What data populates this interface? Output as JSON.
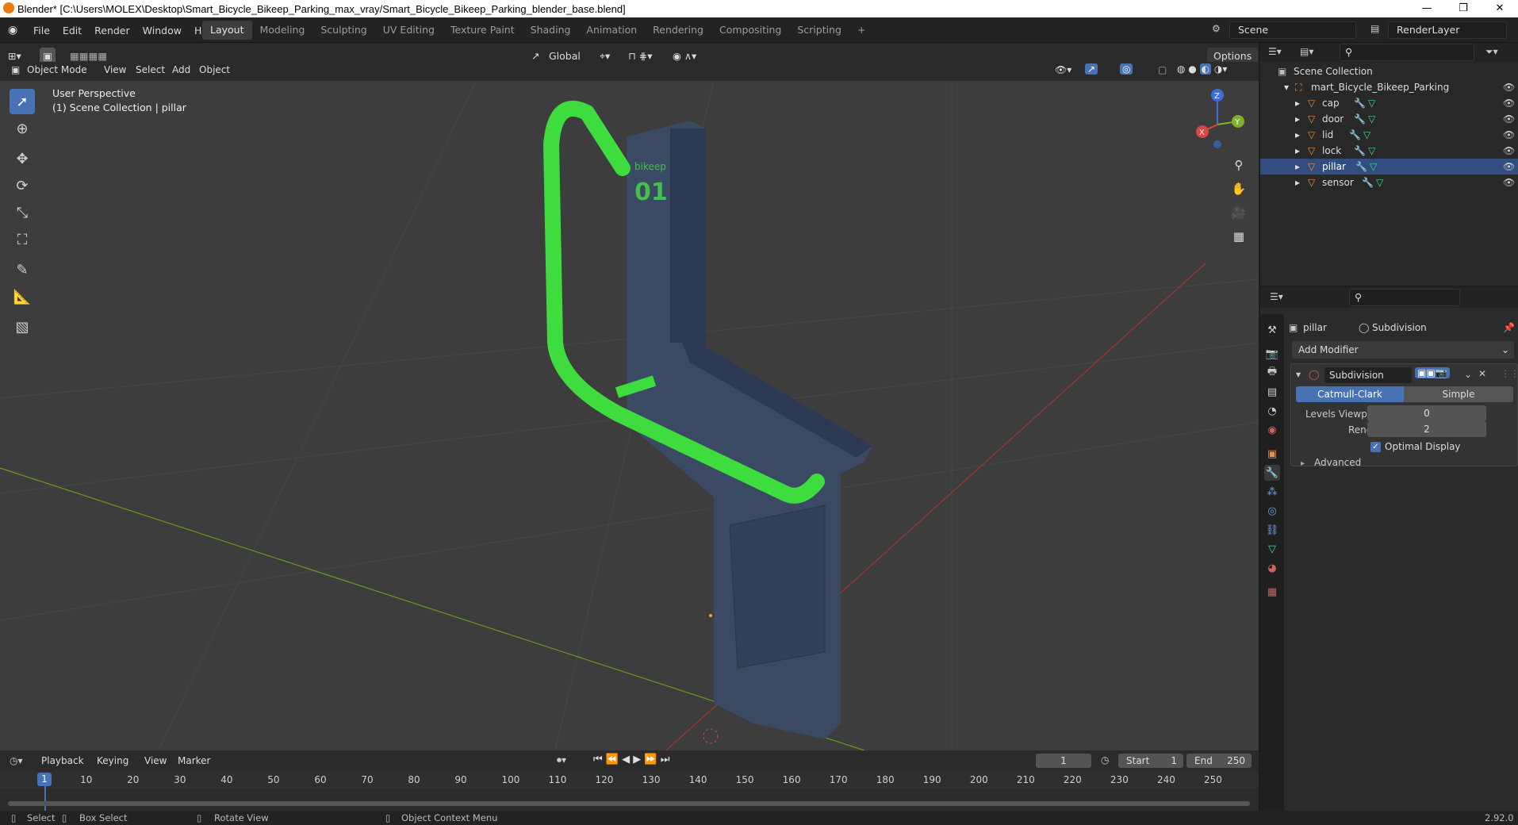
{
  "title": "Blender* [C:\\Users\\MOLEX\\Desktop\\Smart_Bicycle_Bikeep_Parking_max_vray/Smart_Bicycle_Bikeep_Parking_blender_base.blend]",
  "menu": [
    "File",
    "Edit",
    "Render",
    "Window",
    "Help"
  ],
  "workspaces": [
    "Layout",
    "Modeling",
    "Sculpting",
    "UV Editing",
    "Texture Paint",
    "Shading",
    "Animation",
    "Rendering",
    "Compositing",
    "Scripting"
  ],
  "scene": "Scene",
  "view_layer": "RenderLayer",
  "viewport_header": {
    "mode": "Object Mode",
    "menus": [
      "View",
      "Select",
      "Add",
      "Object"
    ],
    "orientation": "Global",
    "options": "Options"
  },
  "overlay": {
    "line1": "User Perspective",
    "line2": "(1) Scene Collection | pillar"
  },
  "model_text": {
    "brand": "bikeep",
    "number": "01"
  },
  "axes": {
    "x": "X",
    "y": "Y",
    "z": "Z"
  },
  "outliner": {
    "root": "Scene Collection",
    "collection": "mart_Bicycle_Bikeep_Parking",
    "objects": [
      "cap",
      "door",
      "lid",
      "lock",
      "pillar",
      "sensor"
    ]
  },
  "properties": {
    "object": "pillar",
    "modifier_crumb": "Subdivision",
    "add_modifier": "Add Modifier",
    "modifier_name": "Subdivision",
    "type_catmull": "Catmull-Clark",
    "type_simple": "Simple",
    "levels_viewport_label": "Levels Viewport",
    "levels_viewport": "0",
    "render_label": "Render",
    "render": "2",
    "optimal_display": "Optimal Display",
    "advanced": "Advanced"
  },
  "timeline": {
    "menus": [
      "Playback",
      "Keying",
      "View",
      "Marker"
    ],
    "current_frame": "1",
    "start_label": "Start",
    "start": "1",
    "end_label": "End",
    "end": "250",
    "ticks": [
      "1",
      "10",
      "20",
      "30",
      "40",
      "50",
      "60",
      "70",
      "80",
      "90",
      "100",
      "110",
      "120",
      "130",
      "140",
      "150",
      "160",
      "170",
      "180",
      "190",
      "200",
      "210",
      "220",
      "230",
      "240",
      "250"
    ]
  },
  "status": {
    "select": "Select",
    "box_select": "Box Select",
    "rotate_view": "Rotate View",
    "context_menu": "Object Context Menu",
    "version": "2.92.0"
  },
  "colors": {
    "accent": "#4772b3",
    "green": "#3fdc3f",
    "pillar": "#3a4a62",
    "grid_x": "#a83232",
    "grid_y": "#6a9a22"
  }
}
